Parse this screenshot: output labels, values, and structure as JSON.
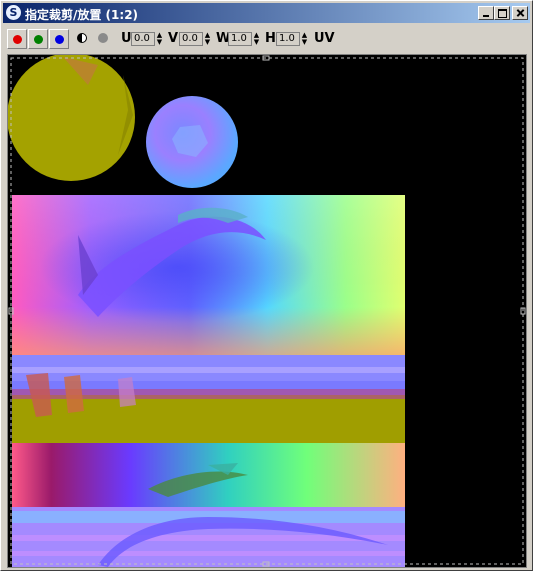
{
  "window": {
    "title": "指定裁剪/放置 (1:2)",
    "app_icon": "s-logo-icon",
    "controls": [
      "minimize-icon",
      "maximize-icon",
      "close-icon"
    ]
  },
  "toolbar": {
    "channels": [
      {
        "name": "red-channel",
        "color": "#e00000"
      },
      {
        "name": "green-channel",
        "color": "#008000"
      },
      {
        "name": "blue-channel",
        "color": "#0000e0"
      }
    ],
    "alpha_icon": "contrast-icon",
    "mono_icon": "gray-dot-icon",
    "u": {
      "label": "U",
      "value": "0.0"
    },
    "v": {
      "label": "V",
      "value": "0.0"
    },
    "w": {
      "label": "W",
      "value": "1.0"
    },
    "h": {
      "label": "H",
      "value": "1.0"
    },
    "uv_label": "UV"
  },
  "viewport": {
    "background": "#000000",
    "content": "normal-map-texture"
  }
}
